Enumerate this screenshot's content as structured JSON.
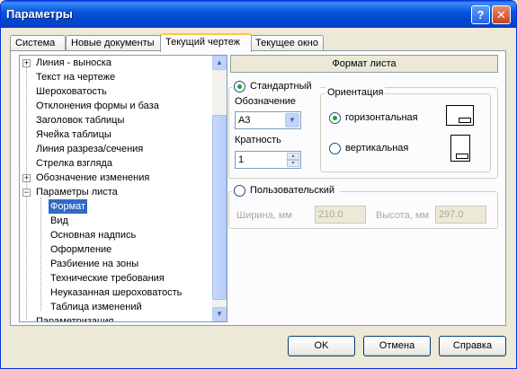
{
  "window": {
    "title": "Параметры",
    "help_icon": "?",
    "close_icon": "✕"
  },
  "tabs": [
    {
      "label": "Система"
    },
    {
      "label": "Новые документы"
    },
    {
      "label": "Текущий чертеж",
      "active": true
    },
    {
      "label": "Текущее окно"
    }
  ],
  "tree": {
    "items": [
      {
        "label": "Линия - выноска",
        "expander": "+"
      },
      {
        "label": "Текст на чертеже"
      },
      {
        "label": "Шероховатость"
      },
      {
        "label": "Отклонения формы и база"
      },
      {
        "label": "Заголовок таблицы"
      },
      {
        "label": "Ячейка таблицы"
      },
      {
        "label": "Линия разреза/сечения"
      },
      {
        "label": "Стрелка взгляда"
      },
      {
        "label": "Обозначение изменения",
        "expander": "+"
      },
      {
        "label": "Параметры листа",
        "expander": "−"
      },
      {
        "label": "Формат",
        "selected": true
      },
      {
        "label": "Вид"
      },
      {
        "label": "Основная надпись"
      },
      {
        "label": "Оформление"
      },
      {
        "label": "Разбиение на зоны"
      },
      {
        "label": "Технические требования"
      },
      {
        "label": "Неуказанная шероховатость"
      },
      {
        "label": "Таблица изменений"
      },
      {
        "label": "Параметризация"
      }
    ],
    "scroll_up": "▲",
    "scroll_down": "▼"
  },
  "format": {
    "header": "Формат листа",
    "standard_label": "Стандартный",
    "designation_label": "Обозначение",
    "designation_value": "А3",
    "multiplicity_label": "Кратность",
    "multiplicity_value": "1",
    "combo_arrow": "▼",
    "spin_up": "▲",
    "spin_down": "▼",
    "orientation_label": "Ориентация",
    "horizontal_label": "горизонтальная",
    "vertical_label": "вертикальная",
    "custom_label": "Пользовательский",
    "width_label": "Ширина, мм",
    "width_value": "210.0",
    "height_label": "Высота, мм",
    "height_value": "297.0"
  },
  "buttons": {
    "ok": "OK",
    "cancel": "Отмена",
    "help": "Справка"
  },
  "colors": {
    "selection": "#316ac5",
    "radio_dot": "#21a121",
    "tab_highlight": "#ffc83c"
  }
}
